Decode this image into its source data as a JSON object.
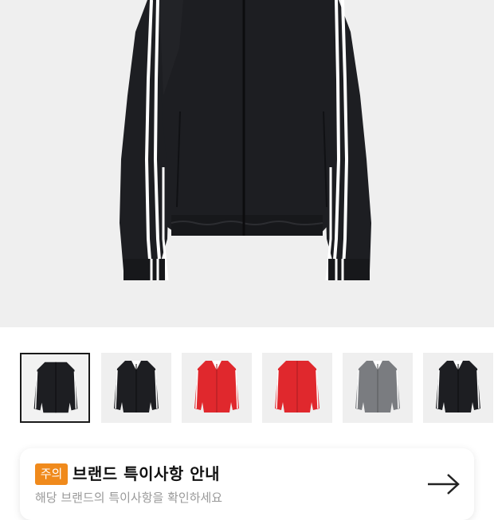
{
  "notice": {
    "badge": "주의",
    "title": "브랜드 특이사항 안내",
    "subtitle": "해당 브랜드의 특이사항을 확인하세요"
  },
  "colors": {
    "background": "#efefef",
    "badge": "#f08a1c",
    "jacket_black": "#1d1e22",
    "jacket_red": "#e0282d",
    "jacket_grey": "#7a7c80"
  },
  "thumbnails": [
    {
      "color": "black",
      "selected": true
    },
    {
      "color": "black",
      "selected": false
    },
    {
      "color": "red",
      "selected": false
    },
    {
      "color": "red",
      "selected": false
    },
    {
      "color": "grey",
      "selected": false
    },
    {
      "color": "black",
      "selected": false
    }
  ],
  "icons": {
    "arrow": "arrow-right-icon"
  }
}
